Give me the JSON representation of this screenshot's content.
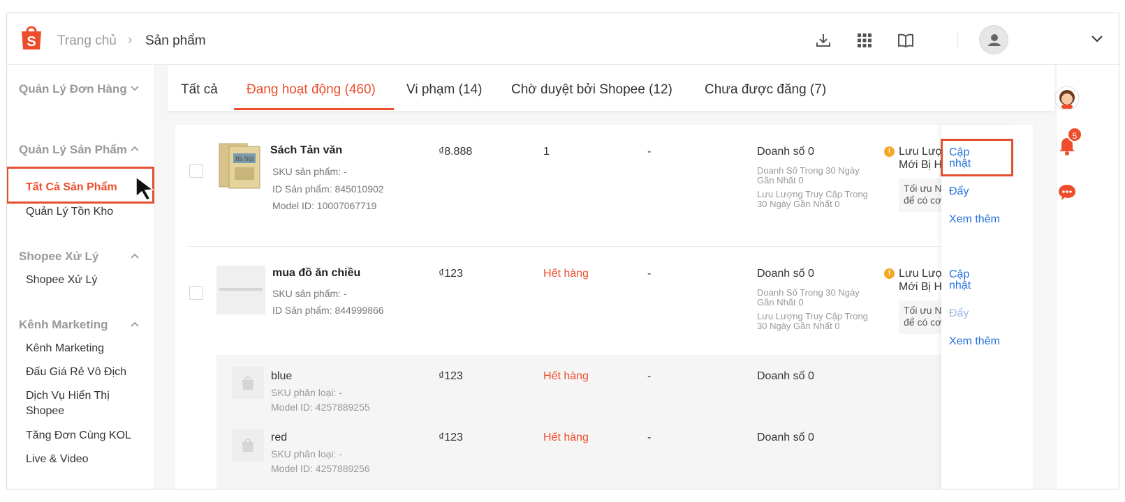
{
  "header": {
    "breadcrumb_home": "Trang chủ",
    "breadcrumb_sep": "›",
    "breadcrumb_current": "Sản phẩm",
    "icons": [
      "download-icon",
      "apps-grid-icon",
      "book-icon",
      "user-avatar",
      "chevron-down-icon"
    ]
  },
  "sidebar": {
    "sections": [
      {
        "title": "Quản Lý Đơn Hàng",
        "expanded": false,
        "items": []
      },
      {
        "title": "Quản Lý Sản Phẩm",
        "expanded": true,
        "items": [
          "Tất Cả Sản Phẩm",
          "Quản Lý Tồn Kho"
        ]
      },
      {
        "title": "Shopee Xử Lý",
        "expanded": true,
        "items": [
          "Shopee Xử Lý"
        ]
      },
      {
        "title": "Kênh Marketing",
        "expanded": true,
        "items": [
          "Kênh Marketing",
          "Đấu Giá Rẻ Vô Địch",
          "Dịch Vụ Hiển Thị Shopee",
          "Tăng Đơn Cùng KOL",
          "Live & Video"
        ]
      }
    ],
    "active_item": "Tất Cả Sản Phẩm"
  },
  "tabs": [
    {
      "label": "Tất cả",
      "active": false
    },
    {
      "label": "Đang hoạt động (460)",
      "active": true
    },
    {
      "label": "Vi phạm (14)",
      "active": false
    },
    {
      "label": "Chờ duyệt bởi Shopee (12)",
      "active": false
    },
    {
      "label": "Chưa được đăng (7)",
      "active": false
    }
  ],
  "products": [
    {
      "name": "Sách Tản văn",
      "sku": "SKU sản phẩm: -",
      "product_id": "ID Sản phẩm: 845010902",
      "model_id": "Model ID: 10007067719",
      "price": "₫8.888",
      "stock": "1",
      "promo": "-",
      "sales": "Doanh số 0",
      "sales_30d": "Doanh Số Trong 30 Ngày Gần Nhất 0",
      "traffic_30d": "Lưu Lượng Truy Cập Trong 30 Ngày Gần Nhất 0",
      "notice_line1": "Lưu Lượng",
      "notice_line2": "Mới Bị Hạn",
      "tip_line1": "Tối ưu N",
      "tip_line2": "để có cơ",
      "actions": {
        "update": "Cập nhật",
        "push": "Đẩy",
        "more": "Xem thêm"
      }
    },
    {
      "name": "mua đồ ăn chiều",
      "sku": "SKU sản phẩm: -",
      "product_id": "ID Sản phẩm: 844999866",
      "price": "₫123",
      "stock": "Hết hàng",
      "promo": "-",
      "sales": "Doanh số 0",
      "sales_30d": "Doanh Số Trong 30 Ngày Gần Nhất 0",
      "traffic_30d": "Lưu Lượng Truy Cập Trong 30 Ngày Gần Nhất 0",
      "notice_line1": "Lưu Lượng",
      "notice_line2": "Mới Bị Hạn",
      "tip_line1": "Tối ưu N",
      "tip_line2": "để có cơ",
      "actions": {
        "update": "Cập nhật",
        "push": "Đẩy",
        "more": "Xem thêm"
      },
      "variants": [
        {
          "name": "blue",
          "sku": "SKU phân loại: -",
          "model_id": "Model ID: 4257889255",
          "price": "₫123",
          "stock": "Hết hàng",
          "promo": "-",
          "sales": "Doanh số 0"
        },
        {
          "name": "red",
          "sku": "SKU phân loại: -",
          "model_id": "Model ID: 4257889256",
          "price": "₫123",
          "stock": "Hết hàng",
          "promo": "-",
          "sales": "Doanh số 0"
        }
      ]
    }
  ],
  "right_rail": {
    "notification_count": "5"
  },
  "colors": {
    "brand": "#ee4d2d",
    "link": "#2673dd",
    "highlight": "#e2502f"
  }
}
